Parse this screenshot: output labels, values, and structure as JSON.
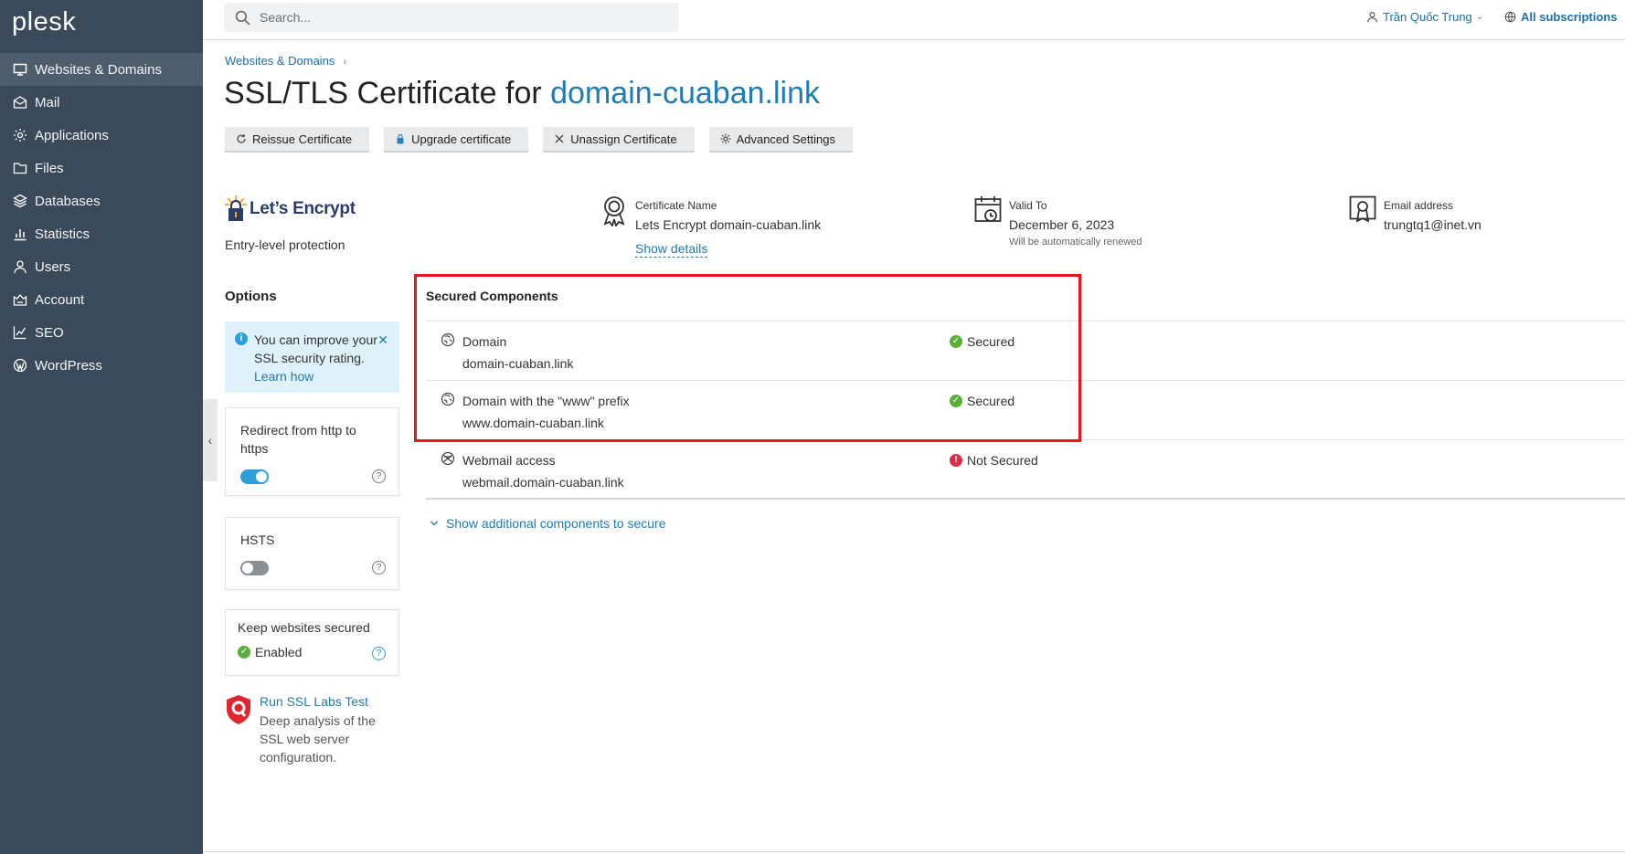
{
  "app": {
    "logo": "plesk"
  },
  "sidebar": {
    "items": [
      {
        "label": "Websites & Domains",
        "icon": "monitor-icon",
        "active": true
      },
      {
        "label": "Mail",
        "icon": "mail-icon"
      },
      {
        "label": "Applications",
        "icon": "gear-icon"
      },
      {
        "label": "Files",
        "icon": "folder-icon"
      },
      {
        "label": "Databases",
        "icon": "database-icon"
      },
      {
        "label": "Statistics",
        "icon": "bar-chart-icon"
      },
      {
        "label": "Users",
        "icon": "user-icon"
      },
      {
        "label": "Account",
        "icon": "account-icon"
      },
      {
        "label": "SEO",
        "icon": "seo-chart-icon"
      },
      {
        "label": "WordPress",
        "icon": "wordpress-icon"
      }
    ]
  },
  "topbar": {
    "search_placeholder": "Search...",
    "user_name": "Trần Quốc Trung",
    "user_chevron": "⌄",
    "subscriptions": "All subscriptions"
  },
  "breadcrumb": {
    "item": "Websites & Domains",
    "sep": "›"
  },
  "page": {
    "title_prefix": "SSL/TLS Certificate for ",
    "title_domain": "domain-cuaban.link"
  },
  "toolbar": {
    "reissue": "Reissue Certificate",
    "upgrade": "Upgrade certificate",
    "unassign": "Unassign Certificate",
    "advanced": "Advanced Settings"
  },
  "certificate": {
    "provider_logo_text": "Let’s Encrypt",
    "provider_sub": "Entry-level protection",
    "name_label": "Certificate Name",
    "name_value": "Lets Encrypt domain-cuaban.link",
    "show_details": "Show details",
    "valid_label": "Valid To",
    "valid_value": "December 6, 2023",
    "valid_note": "Will be automatically renewed",
    "email_label": "Email address",
    "email_value": "trungtq1@inet.vn"
  },
  "options": {
    "title": "Options",
    "hint_text": "You can improve your SSL security rating.",
    "hint_link": "Learn how",
    "hint_close": "✕",
    "redirect_label": "Redirect from http to https",
    "redirect_on": true,
    "hsts_label": "HSTS",
    "hsts_on": false,
    "keep_label": "Keep websites secured",
    "keep_status": "Enabled",
    "qmark": "?",
    "ssl_labs_link": "Run SSL Labs Test",
    "ssl_labs_desc": "Deep analysis of the SSL web server configuration."
  },
  "secured_components": {
    "title": "Secured Components",
    "rows": [
      {
        "name": "Domain",
        "host": "domain-cuaban.link",
        "status": "Secured",
        "ok": true,
        "icon": "domain-icon"
      },
      {
        "name": "Domain with the \"www\" prefix",
        "host": "www.domain-cuaban.link",
        "status": "Secured",
        "ok": true,
        "icon": "domain-www-icon"
      },
      {
        "name": "Webmail access",
        "host": "webmail.domain-cuaban.link",
        "status": "Not Secured",
        "ok": false,
        "icon": "webmail-icon"
      }
    ],
    "show_more": "Show additional components to secure"
  },
  "colors": {
    "sidebar_bg": "#3a4a5a",
    "accent": "#1e7bb3",
    "ok": "#5cae3b",
    "bad": "#d9304a",
    "highlight": "#e8141b"
  }
}
